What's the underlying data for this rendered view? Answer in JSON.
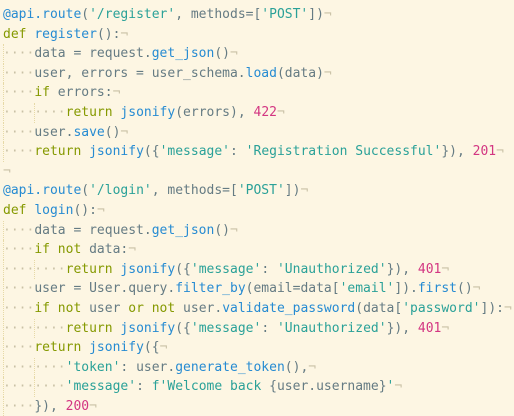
{
  "editor": {
    "language": "python",
    "theme": "solarized-light",
    "colors": {
      "background": "#fdf6e3",
      "text": "#657b83",
      "keyword": "#859900",
      "function": "#268bd2",
      "string": "#2aa198",
      "number": "#d33682",
      "whitespace_marker": "#c9c1a6"
    },
    "eol_marker": "¬",
    "indent_marker": "····",
    "lines": [
      {
        "indent": 0,
        "tokens": [
          [
            "tok-decorator",
            "@api.route"
          ],
          [
            "tok-plain",
            "("
          ],
          [
            "tok-str",
            "'/register'"
          ],
          [
            "tok-plain",
            ", methods=["
          ],
          [
            "tok-str",
            "'POST'"
          ],
          [
            "tok-plain",
            "])"
          ]
        ]
      },
      {
        "indent": 0,
        "tokens": [
          [
            "tok-kw",
            "def "
          ],
          [
            "tok-def",
            "register"
          ],
          [
            "tok-plain",
            "():"
          ]
        ]
      },
      {
        "indent": 1,
        "tokens": [
          [
            "tok-plain",
            "data = request."
          ],
          [
            "tok-call",
            "get_json"
          ],
          [
            "tok-plain",
            "()"
          ]
        ]
      },
      {
        "indent": 1,
        "tokens": [
          [
            "tok-plain",
            "user, errors = user_schema."
          ],
          [
            "tok-call",
            "load"
          ],
          [
            "tok-plain",
            "(data)"
          ]
        ]
      },
      {
        "indent": 1,
        "tokens": [
          [
            "tok-kw",
            "if "
          ],
          [
            "tok-plain",
            "errors:"
          ]
        ]
      },
      {
        "indent": 2,
        "tokens": [
          [
            "tok-kw",
            "return "
          ],
          [
            "tok-call",
            "jsonify"
          ],
          [
            "tok-plain",
            "(errors), "
          ],
          [
            "tok-num",
            "422"
          ]
        ]
      },
      {
        "indent": 1,
        "tokens": [
          [
            "tok-plain",
            "user."
          ],
          [
            "tok-call",
            "save"
          ],
          [
            "tok-plain",
            "()"
          ]
        ]
      },
      {
        "indent": 1,
        "tokens": [
          [
            "tok-kw",
            "return "
          ],
          [
            "tok-call",
            "jsonify"
          ],
          [
            "tok-plain",
            "({"
          ],
          [
            "tok-str",
            "'message'"
          ],
          [
            "tok-plain",
            ": "
          ],
          [
            "tok-str",
            "'Registration Successful'"
          ],
          [
            "tok-plain",
            "}), "
          ],
          [
            "tok-num",
            "201"
          ]
        ]
      },
      {
        "indent": 0,
        "tokens": []
      },
      {
        "indent": 0,
        "tokens": [
          [
            "tok-decorator",
            "@api.route"
          ],
          [
            "tok-plain",
            "("
          ],
          [
            "tok-str",
            "'/login'"
          ],
          [
            "tok-plain",
            ", methods=["
          ],
          [
            "tok-str",
            "'POST'"
          ],
          [
            "tok-plain",
            "])"
          ]
        ]
      },
      {
        "indent": 0,
        "tokens": [
          [
            "tok-kw",
            "def "
          ],
          [
            "tok-def",
            "login"
          ],
          [
            "tok-plain",
            "():"
          ]
        ]
      },
      {
        "indent": 1,
        "tokens": [
          [
            "tok-plain",
            "data = request."
          ],
          [
            "tok-call",
            "get_json"
          ],
          [
            "tok-plain",
            "()"
          ]
        ]
      },
      {
        "indent": 1,
        "tokens": [
          [
            "tok-kw",
            "if not "
          ],
          [
            "tok-plain",
            "data:"
          ]
        ]
      },
      {
        "indent": 2,
        "tokens": [
          [
            "tok-kw",
            "return "
          ],
          [
            "tok-call",
            "jsonify"
          ],
          [
            "tok-plain",
            "({"
          ],
          [
            "tok-str",
            "'message'"
          ],
          [
            "tok-plain",
            ": "
          ],
          [
            "tok-str",
            "'Unauthorized'"
          ],
          [
            "tok-plain",
            "}), "
          ],
          [
            "tok-num",
            "401"
          ]
        ]
      },
      {
        "indent": 1,
        "tokens": [
          [
            "tok-plain",
            "user = User.query."
          ],
          [
            "tok-call",
            "filter_by"
          ],
          [
            "tok-plain",
            "(email=data["
          ],
          [
            "tok-str",
            "'email'"
          ],
          [
            "tok-plain",
            "])."
          ],
          [
            "tok-call",
            "first"
          ],
          [
            "tok-plain",
            "()"
          ]
        ]
      },
      {
        "indent": 1,
        "tokens": [
          [
            "tok-kw",
            "if not "
          ],
          [
            "tok-plain",
            "user "
          ],
          [
            "tok-kw",
            "or not "
          ],
          [
            "tok-plain",
            "user."
          ],
          [
            "tok-call",
            "validate_password"
          ],
          [
            "tok-plain",
            "(data["
          ],
          [
            "tok-str",
            "'password'"
          ],
          [
            "tok-plain",
            "]):"
          ]
        ]
      },
      {
        "indent": 2,
        "tokens": [
          [
            "tok-kw",
            "return "
          ],
          [
            "tok-call",
            "jsonify"
          ],
          [
            "tok-plain",
            "({"
          ],
          [
            "tok-str",
            "'message'"
          ],
          [
            "tok-plain",
            ": "
          ],
          [
            "tok-str",
            "'Unauthorized'"
          ],
          [
            "tok-plain",
            "}), "
          ],
          [
            "tok-num",
            "401"
          ]
        ]
      },
      {
        "indent": 1,
        "tokens": [
          [
            "tok-kw",
            "return "
          ],
          [
            "tok-call",
            "jsonify"
          ],
          [
            "tok-plain",
            "({"
          ]
        ]
      },
      {
        "indent": 2,
        "tokens": [
          [
            "tok-str",
            "'token'"
          ],
          [
            "tok-plain",
            ": user."
          ],
          [
            "tok-call",
            "generate_token"
          ],
          [
            "tok-plain",
            "(),"
          ]
        ]
      },
      {
        "indent": 2,
        "tokens": [
          [
            "tok-str",
            "'message'"
          ],
          [
            "tok-plain",
            ": "
          ],
          [
            "tok-str",
            "f'Welcome back "
          ],
          [
            "tok-plain",
            "{user.username}"
          ],
          [
            "tok-str",
            "'"
          ]
        ]
      },
      {
        "indent": 1,
        "tokens": [
          [
            "tok-plain",
            "}), "
          ],
          [
            "tok-num",
            "200"
          ]
        ]
      }
    ]
  }
}
